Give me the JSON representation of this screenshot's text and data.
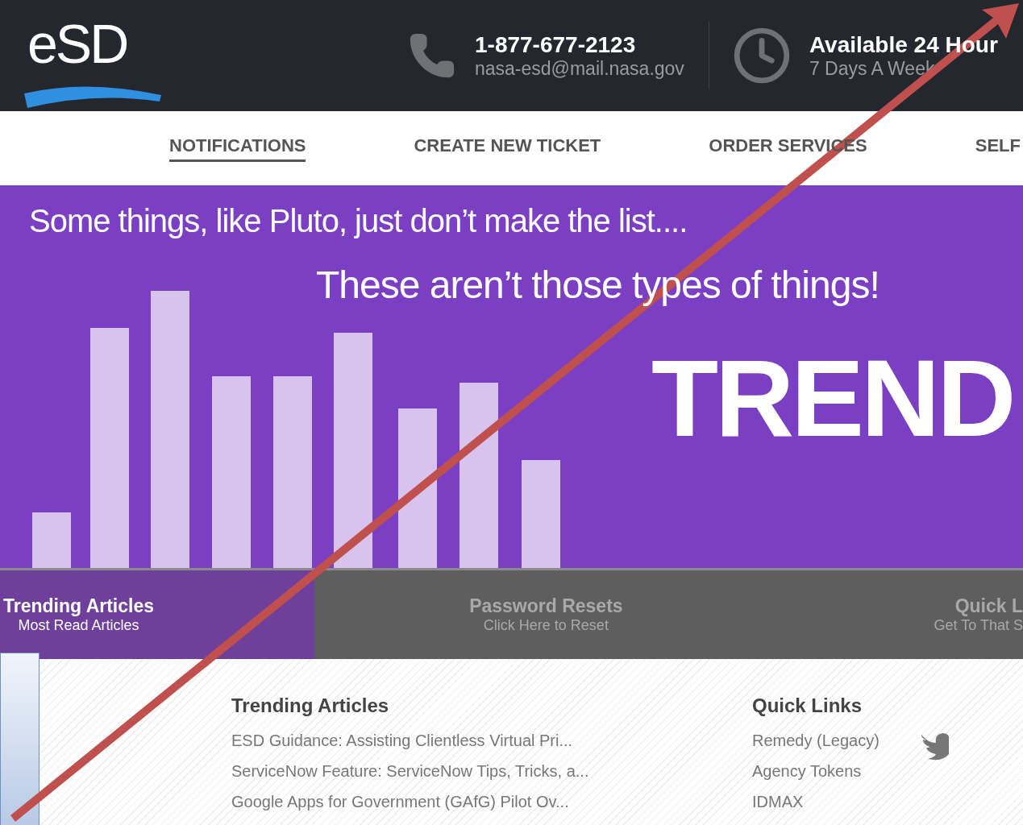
{
  "header": {
    "logo": "eSD",
    "phone": "1-877-677-2123",
    "email": "nasa-esd@mail.nasa.gov",
    "hours_title": "Available 24 Hour",
    "hours_sub": "7 Days A Week"
  },
  "nav": [
    {
      "label": "NOTIFICATIONS",
      "selected": true
    },
    {
      "label": "CREATE NEW TICKET",
      "selected": false
    },
    {
      "label": "ORDER SERVICES",
      "selected": false
    },
    {
      "label": "SELF",
      "selected": false
    }
  ],
  "banner": {
    "line1": "Some things, like Pluto, just don’t make the list....",
    "line2": "These aren’t those types of things!",
    "headline": "TREND"
  },
  "tabs": [
    {
      "title": "Trending Articles",
      "subtitle": "Most Read Articles",
      "selected": true
    },
    {
      "title": "Password Resets",
      "subtitle": "Click Here to Reset",
      "selected": false
    },
    {
      "title": "Quick L",
      "subtitle": "Get To That S",
      "selected": false
    }
  ],
  "trending": {
    "heading": "Trending Articles",
    "items": [
      "ESD Guidance: Assisting Clientless Virtual Pri...",
      "ServiceNow Feature: ServiceNow Tips, Tricks, a...",
      "Google Apps for Government (GAfG) Pilot Ov..."
    ]
  },
  "quick_links": {
    "heading": "Quick Links",
    "items": [
      "Remedy (Legacy)",
      "Agency Tokens",
      "IDMAX"
    ]
  }
}
